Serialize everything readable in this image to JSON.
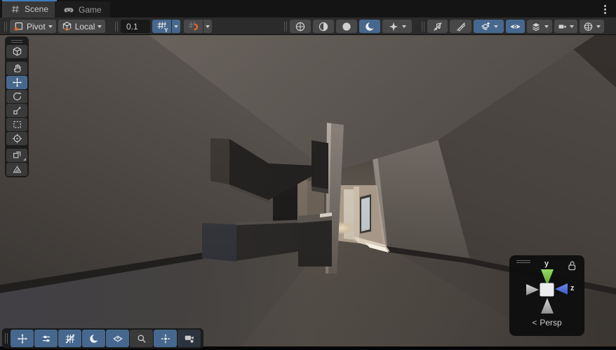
{
  "tabs": [
    {
      "label": "Scene",
      "icon": "grid-icon",
      "active": true
    },
    {
      "label": "Game",
      "icon": "gamepad-icon",
      "active": false
    }
  ],
  "window": {
    "menu_icon": "kebab-vertical-dots"
  },
  "toolbar": {
    "pivot": {
      "label": "Pivot",
      "icon": "pivot-icon",
      "has_dropdown": true
    },
    "rotation": {
      "label": "Local",
      "icon": "local-cube-icon",
      "has_dropdown": true
    },
    "grid_size_value": "0.1",
    "grid_axis_letter": "Y",
    "toggles": [
      {
        "name": "grid-visibility",
        "icon": "grid-y-icon",
        "active": true,
        "has_dropdown": true
      },
      {
        "name": "snap-increment",
        "icon": "magnet-grid-icon",
        "active": false,
        "has_dropdown": true
      },
      {
        "name": "draw-mode-wire-sphere",
        "icon": "sphere-cross-icon",
        "active": false
      },
      {
        "name": "draw-mode-half-sphere",
        "icon": "sphere-half-icon",
        "active": false
      },
      {
        "name": "draw-mode-sphere",
        "icon": "sphere-filled-icon",
        "active": false
      },
      {
        "name": "scene-lighting",
        "icon": "crescent-moon-icon",
        "active": true
      },
      {
        "name": "effects",
        "icon": "sparkle-icon",
        "active": false,
        "has_dropdown": true
      },
      {
        "name": "audio-muted",
        "icon": "note-slash-icon",
        "active": false
      },
      {
        "name": "fx-muted",
        "icon": "brush-slash-icon",
        "active": false
      },
      {
        "name": "scene-visibility",
        "icon": "layers-sparkle-icon",
        "active": true,
        "has_dropdown": true
      },
      {
        "name": "camera-visibility",
        "icon": "eye-icon",
        "active": true
      },
      {
        "name": "layers",
        "icon": "layer-stack-icon",
        "active": false,
        "has_dropdown": true
      },
      {
        "name": "cameras",
        "icon": "video-camera-icon",
        "active": false,
        "has_dropdown": true
      },
      {
        "name": "gizmos",
        "icon": "gizmo-sphere-icon",
        "active": false,
        "has_dropdown": true
      }
    ]
  },
  "tools_overlay": [
    {
      "name": "view-tool",
      "icon": "cube-icon",
      "active": false
    },
    {
      "name": "pan-tool",
      "icon": "hand-icon",
      "active": false
    },
    {
      "name": "move-tool",
      "icon": "move-arrows-icon",
      "active": true
    },
    {
      "name": "rotate-tool",
      "icon": "rotate-icon",
      "active": false
    },
    {
      "name": "scale-tool",
      "icon": "scale-icon",
      "active": false
    },
    {
      "name": "rect-tool",
      "icon": "rect-icon",
      "active": false
    },
    {
      "name": "transform-tool",
      "icon": "transform-icon",
      "active": false
    },
    {
      "name": "custom-tool",
      "icon": "cube-corner-icon",
      "active": false
    },
    {
      "name": "mesh-edit-tool",
      "icon": "mesh-icon",
      "active": false
    }
  ],
  "bottom_overlay": [
    {
      "name": "tools-toggle",
      "icon": "move-arrows-icon",
      "active": true
    },
    {
      "name": "tool-settings-toggle",
      "icon": "sliders-icon",
      "active": true
    },
    {
      "name": "grid-snap-toggle",
      "icon": "grid-slash-icon",
      "active": true
    },
    {
      "name": "view-options-toggle",
      "icon": "crescent-moon-icon",
      "active": true
    },
    {
      "name": "gizmos-toggle",
      "icon": "diamond-icon",
      "active": true
    },
    {
      "name": "search-toggle",
      "icon": "search-icon",
      "active": false
    },
    {
      "name": "orientation-toggle",
      "icon": "center-cross-icon",
      "active": true
    },
    {
      "name": "cameras-toggle",
      "icon": "video-camera-dot-icon",
      "active": false
    }
  ],
  "orientation_gizmo": {
    "y_axis_label": "y",
    "z_axis_label": "z",
    "projection_chevron": "<",
    "projection_label": "Persp",
    "y_axis_color": "#7dc855",
    "z_axis_color": "#4f74e3",
    "locked": false
  },
  "colors": {
    "selection_blue": "#47688e",
    "tab_accent": "#3e7cb8",
    "snap_orange": "#e0662e"
  }
}
